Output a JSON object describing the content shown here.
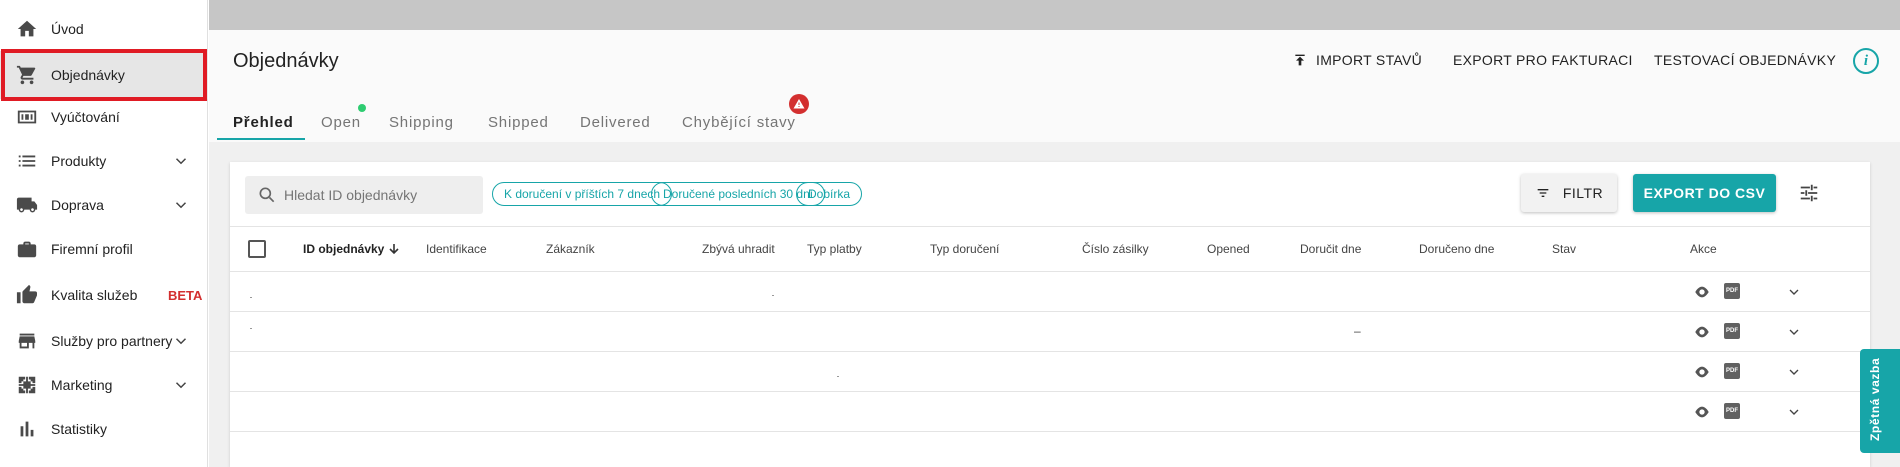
{
  "sidebar": {
    "items": [
      {
        "label": "Úvod",
        "icon": "home-icon"
      },
      {
        "label": "Objednávky",
        "icon": "cart-icon",
        "active": true
      },
      {
        "label": "Vyúčtování",
        "icon": "billing-icon"
      },
      {
        "label": "Produkty",
        "icon": "list-icon",
        "expandable": true
      },
      {
        "label": "Doprava",
        "icon": "truck-icon",
        "expandable": true
      },
      {
        "label": "Firemní profil",
        "icon": "briefcase-icon"
      },
      {
        "label": "Kvalita služeb",
        "icon": "thumb-up-icon",
        "badge": "BETA"
      },
      {
        "label": "Služby pro partnery",
        "icon": "store-icon",
        "expandable": true
      },
      {
        "label": "Marketing",
        "icon": "marketing-icon",
        "expandable": true
      },
      {
        "label": "Statistiky",
        "icon": "bar-chart-icon"
      }
    ]
  },
  "header": {
    "title": "Objednávky",
    "actions": {
      "import": "IMPORT STAVŮ",
      "export_invoice": "EXPORT PRO FAKTURACI",
      "test_orders": "TESTOVACÍ OBJEDNÁVKY",
      "info": "i"
    }
  },
  "tabs": [
    {
      "label": "Přehled",
      "active": true
    },
    {
      "label": "Open",
      "indicator": "green-dot"
    },
    {
      "label": "Shipping"
    },
    {
      "label": "Shipped"
    },
    {
      "label": "Delivered"
    },
    {
      "label": "Chybějící stavy",
      "indicator": "warning-badge"
    }
  ],
  "toolbar": {
    "search_placeholder": "Hledat ID objednávky",
    "chips": [
      "K doručení v příštích 7 dnech",
      "Doručené posledních 30 dní",
      "Dobírka"
    ],
    "filter_label": "FILTR",
    "export_csv_label": "EXPORT DO CSV"
  },
  "table": {
    "columns": [
      "ID objednávky",
      "Identifikace",
      "Zákazník",
      "Zbývá uhradit",
      "Typ platby",
      "Typ doručení",
      "Číslo zásilky",
      "Opened",
      "Doručit dne",
      "Doručeno dne",
      "Stav",
      "Akce"
    ],
    "sort_column": "ID objednávky",
    "row_count": 4,
    "row_actions": {
      "pdf": "PDF"
    },
    "row2_delivery_value": "–"
  },
  "feedback_tab": "Zpětná vazba",
  "colors": {
    "accent": "#17a5a8",
    "danger": "#d32f2f",
    "success": "#2ecc71",
    "highlight_outline": "#e01b24"
  }
}
